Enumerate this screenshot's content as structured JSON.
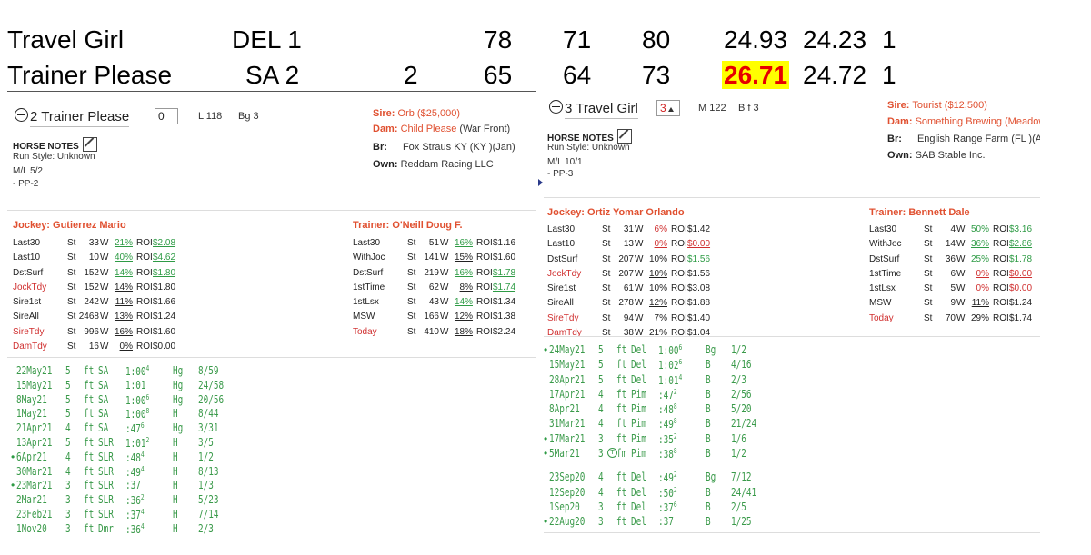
{
  "summary": {
    "rows": [
      {
        "name": "Travel Girl",
        "track": "DEL 1",
        "extra": "",
        "c1": "78",
        "c2": "71",
        "c3": "80",
        "c4": "24.93",
        "c5": "24.23",
        "c6": "1",
        "highlight": false
      },
      {
        "name": "Trainer Please",
        "track": "SA 2",
        "extra": "2",
        "c1": "65",
        "c2": "64",
        "c3": "73",
        "c4": "26.71",
        "c5": "24.72",
        "c6": "1",
        "highlight": true
      }
    ],
    "highlight_color": "#ffff00",
    "highlight_text_color": "#e60000"
  },
  "left": {
    "title": "2 Trainer Please",
    "pg_value": "0",
    "ml_info": "L 118",
    "sex": "Bg 3",
    "sire_label": "Sire:",
    "sire_value": "Orb ($25,000)",
    "dam_label": "Dam:",
    "dam_value": "Child Please",
    "dam_extra": "(War Front)",
    "br_label": "Br:",
    "br_value": "Fox Straus KY (KY )(Jan)",
    "own_label": "Own:",
    "own_value": "Reddam Racing LLC",
    "notes_label": "HORSE NOTES",
    "run_style": "Run Style: Unknown",
    "ml": "M/L  5/2",
    "pp": "-  PP-2",
    "jockey_header": "Jockey: Gutierrez Mario",
    "trainer_header": "Trainer: O'Neill Doug F.",
    "jockey_stats": [
      {
        "label": "Last30",
        "st": "St",
        "n": "33",
        "w": "W",
        "pct": "21%",
        "roi": "ROI",
        "val": "$2.08",
        "label_red": false,
        "pct_color": "green",
        "val_color": "green"
      },
      {
        "label": "Last10",
        "st": "St",
        "n": "10",
        "w": "W",
        "pct": "40%",
        "roi": "ROI",
        "val": "$4.62",
        "label_red": false,
        "pct_color": "green",
        "val_color": "green"
      },
      {
        "label": "DstSurf",
        "st": "St",
        "n": "152",
        "w": "W",
        "pct": "14%",
        "roi": "ROI",
        "val": "$1.80",
        "label_red": false,
        "pct_color": "green",
        "val_color": "green"
      },
      {
        "label": "JockTdy",
        "st": "St",
        "n": "152",
        "w": "W",
        "pct": "14%",
        "roi": "ROI",
        "val": "$1.80",
        "label_red": true,
        "pct_color": "",
        "val_color": ""
      },
      {
        "label": "Sire1st",
        "st": "St",
        "n": "242",
        "w": "W",
        "pct": "11%",
        "roi": "ROI",
        "val": "$1.66",
        "label_red": false,
        "pct_color": "",
        "val_color": ""
      },
      {
        "label": "SireAll",
        "st": "St",
        "n": "2468",
        "w": "W",
        "pct": "13%",
        "roi": "ROI",
        "val": "$1.24",
        "label_red": false,
        "pct_color": "",
        "val_color": ""
      },
      {
        "label": "SireTdy",
        "st": "St",
        "n": "996",
        "w": "W",
        "pct": "16%",
        "roi": "ROI",
        "val": "$1.60",
        "label_red": true,
        "pct_color": "",
        "val_color": ""
      },
      {
        "label": "DamTdy",
        "st": "St",
        "n": "16",
        "w": "W",
        "pct": "0%",
        "roi": "ROI",
        "val": "$0.00",
        "label_red": true,
        "pct_color": "",
        "val_color": ""
      }
    ],
    "trainer_stats": [
      {
        "label": "Last30",
        "st": "St",
        "n": "51",
        "w": "W",
        "pct": "16%",
        "roi": "ROI",
        "val": "$1.16",
        "label_red": false,
        "pct_color": "green",
        "val_color": ""
      },
      {
        "label": "WithJoc",
        "st": "St",
        "n": "141",
        "w": "W",
        "pct": "15%",
        "roi": "ROI",
        "val": "$1.60",
        "label_red": false,
        "pct_color": "",
        "val_color": ""
      },
      {
        "label": "DstSurf",
        "st": "St",
        "n": "219",
        "w": "W",
        "pct": "16%",
        "roi": "ROI",
        "val": "$1.78",
        "label_red": false,
        "pct_color": "green",
        "val_color": "green"
      },
      {
        "label": "1stTime",
        "st": "St",
        "n": "62",
        "w": "W",
        "pct": "8%",
        "roi": "ROI",
        "val": "$1.74",
        "label_red": false,
        "pct_color": "",
        "val_color": "green"
      },
      {
        "label": "1stLsx",
        "st": "St",
        "n": "43",
        "w": "W",
        "pct": "14%",
        "roi": "ROI",
        "val": "$1.34",
        "label_red": false,
        "pct_color": "green",
        "val_color": ""
      },
      {
        "label": "MSW",
        "st": "St",
        "n": "166",
        "w": "W",
        "pct": "12%",
        "roi": "ROI",
        "val": "$1.38",
        "label_red": false,
        "pct_color": "",
        "val_color": ""
      },
      {
        "label": "Today",
        "st": "St",
        "n": "410",
        "w": "W",
        "pct": "18%",
        "roi": "ROI",
        "val": "$2.24",
        "label_red": true,
        "pct_color": "",
        "val_color": ""
      }
    ],
    "workouts": [
      {
        "dot": "",
        "date": "22May21",
        "dist": "5",
        "surf": "ft",
        "trk": "SA",
        "time": "1:00",
        "sup": "4",
        "type": "Hg",
        "rank": "8/59"
      },
      {
        "dot": "",
        "date": "15May21",
        "dist": "5",
        "surf": "ft",
        "trk": "SA",
        "time": "1:01",
        "sup": "",
        "type": "Hg",
        "rank": "24/58"
      },
      {
        "dot": "",
        "date": "8May21",
        "dist": "5",
        "surf": "ft",
        "trk": "SA",
        "time": "1:00",
        "sup": "6",
        "type": "Hg",
        "rank": "20/56"
      },
      {
        "dot": "",
        "date": "1May21",
        "dist": "5",
        "surf": "ft",
        "trk": "SA",
        "time": "1:00",
        "sup": "8",
        "type": "H",
        "rank": "8/44"
      },
      {
        "dot": "",
        "date": "21Apr21",
        "dist": "4",
        "surf": "ft",
        "trk": "SA",
        "time": ":47",
        "sup": "6",
        "type": "Hg",
        "rank": "3/31"
      },
      {
        "dot": "",
        "date": "13Apr21",
        "dist": "5",
        "surf": "ft",
        "trk": "SLR",
        "time": "1:01",
        "sup": "2",
        "type": "H",
        "rank": "3/5"
      },
      {
        "dot": "•",
        "date": "6Apr21",
        "dist": "4",
        "surf": "ft",
        "trk": "SLR",
        "time": ":48",
        "sup": "4",
        "type": "H",
        "rank": "1/2"
      },
      {
        "dot": "",
        "date": "30Mar21",
        "dist": "4",
        "surf": "ft",
        "trk": "SLR",
        "time": ":49",
        "sup": "4",
        "type": "H",
        "rank": "8/13"
      },
      {
        "dot": "•",
        "date": "23Mar21",
        "dist": "3",
        "surf": "ft",
        "trk": "SLR",
        "time": ":37",
        "sup": "",
        "type": "H",
        "rank": "1/3"
      },
      {
        "dot": "",
        "date": "2Mar21",
        "dist": "3",
        "surf": "ft",
        "trk": "SLR",
        "time": ":36",
        "sup": "2",
        "type": "H",
        "rank": "5/23"
      },
      {
        "dot": "",
        "date": "23Feb21",
        "dist": "3",
        "surf": "ft",
        "trk": "SLR",
        "time": ":37",
        "sup": "4",
        "type": "H",
        "rank": "7/14"
      },
      {
        "dot": "",
        "date": "1Nov20",
        "dist": "3",
        "surf": "ft",
        "trk": "Dmr",
        "time": ":36",
        "sup": "4",
        "type": "H",
        "rank": "2/3"
      }
    ]
  },
  "right": {
    "title": "3 Travel Girl",
    "pg_value": "3",
    "ml_info": "M 122",
    "sex": "B f 3",
    "sire_label": "Sire:",
    "sire_value": "Tourist ($12,500)",
    "dam_label": "Dam:",
    "dam_value": "Something Brewing (Meadow",
    "br_label": "Br:",
    "br_value": "English Range Farm (FL )(Apr",
    "own_label": "Own:",
    "own_value": "SAB Stable Inc.",
    "notes_label": "HORSE NOTES",
    "run_style": "Run Style: Unknown",
    "ml": "M/L  10/1",
    "pp": "-  PP-3",
    "jockey_header": "Jockey: Ortiz Yomar Orlando",
    "trainer_header": "Trainer: Bennett Dale",
    "jockey_stats": [
      {
        "label": "Last30",
        "st": "St",
        "n": "31",
        "w": "W",
        "pct": "6%",
        "roi": "ROI",
        "val": "$1.42",
        "label_red": false,
        "pct_color": "red",
        "val_color": ""
      },
      {
        "label": "Last10",
        "st": "St",
        "n": "13",
        "w": "W",
        "pct": "0%",
        "roi": "ROI",
        "val": "$0.00",
        "label_red": false,
        "pct_color": "red",
        "val_color": "red"
      },
      {
        "label": "DstSurf",
        "st": "St",
        "n": "207",
        "w": "W",
        "pct": "10%",
        "roi": "ROI",
        "val": "$1.56",
        "label_red": false,
        "pct_color": "",
        "val_color": "green"
      },
      {
        "label": "JockTdy",
        "st": "St",
        "n": "207",
        "w": "W",
        "pct": "10%",
        "roi": "ROI",
        "val": "$1.56",
        "label_red": true,
        "pct_color": "",
        "val_color": ""
      },
      {
        "label": "Sire1st",
        "st": "St",
        "n": "61",
        "w": "W",
        "pct": "10%",
        "roi": "ROI",
        "val": "$3.08",
        "label_red": false,
        "pct_color": "",
        "val_color": ""
      },
      {
        "label": "SireAll",
        "st": "St",
        "n": "278",
        "w": "W",
        "pct": "12%",
        "roi": "ROI",
        "val": "$1.88",
        "label_red": false,
        "pct_color": "",
        "val_color": ""
      },
      {
        "label": "SireTdy",
        "st": "St",
        "n": "94",
        "w": "W",
        "pct": "7%",
        "roi": "ROI",
        "val": "$1.40",
        "label_red": true,
        "pct_color": "",
        "val_color": ""
      },
      {
        "label": "DamTdy",
        "st": "St",
        "n": "38",
        "w": "W",
        "pct": "21%",
        "roi": "ROI",
        "val": "$1.04",
        "label_red": true,
        "pct_color": "",
        "val_color": ""
      }
    ],
    "trainer_stats": [
      {
        "label": "Last30",
        "st": "St",
        "n": "4",
        "w": "W",
        "pct": "50%",
        "roi": "ROI",
        "val": "$3.16",
        "label_red": false,
        "pct_color": "green",
        "val_color": "green"
      },
      {
        "label": "WithJoc",
        "st": "St",
        "n": "14",
        "w": "W",
        "pct": "36%",
        "roi": "ROI",
        "val": "$2.86",
        "label_red": false,
        "pct_color": "green",
        "val_color": "green"
      },
      {
        "label": "DstSurf",
        "st": "St",
        "n": "36",
        "w": "W",
        "pct": "25%",
        "roi": "ROI",
        "val": "$1.78",
        "label_red": false,
        "pct_color": "green",
        "val_color": "green"
      },
      {
        "label": "1stTime",
        "st": "St",
        "n": "6",
        "w": "W",
        "pct": "0%",
        "roi": "ROI",
        "val": "$0.00",
        "label_red": false,
        "pct_color": "red",
        "val_color": "red"
      },
      {
        "label": "1stLsx",
        "st": "St",
        "n": "5",
        "w": "W",
        "pct": "0%",
        "roi": "ROI",
        "val": "$0.00",
        "label_red": false,
        "pct_color": "red",
        "val_color": "red"
      },
      {
        "label": "MSW",
        "st": "St",
        "n": "9",
        "w": "W",
        "pct": "11%",
        "roi": "ROI",
        "val": "$1.24",
        "label_red": false,
        "pct_color": "",
        "val_color": ""
      },
      {
        "label": "Today",
        "st": "St",
        "n": "70",
        "w": "W",
        "pct": "29%",
        "roi": "ROI",
        "val": "$1.74",
        "label_red": true,
        "pct_color": "",
        "val_color": ""
      }
    ],
    "workouts": [
      {
        "dot": "•",
        "date": "24May21",
        "dist": "5",
        "surf": "ft",
        "trk": "Del",
        "time": "1:00",
        "sup": "6",
        "type": "Bg",
        "rank": "1/2"
      },
      {
        "dot": "",
        "date": "15May21",
        "dist": "5",
        "surf": "ft",
        "trk": "Del",
        "time": "1:02",
        "sup": "6",
        "type": "B",
        "rank": "4/16"
      },
      {
        "dot": "",
        "date": "28Apr21",
        "dist": "5",
        "surf": "ft",
        "trk": "Del",
        "time": "1:01",
        "sup": "4",
        "type": "B",
        "rank": "2/3"
      },
      {
        "dot": "",
        "date": "17Apr21",
        "dist": "4",
        "surf": "ft",
        "trk": "Pim",
        "time": ":47",
        "sup": "2",
        "type": "B",
        "rank": "2/56"
      },
      {
        "dot": "",
        "date": "8Apr21",
        "dist": "4",
        "surf": "ft",
        "trk": "Pim",
        "time": ":48",
        "sup": "8",
        "type": "B",
        "rank": "5/20"
      },
      {
        "dot": "",
        "date": "31Mar21",
        "dist": "4",
        "surf": "ft",
        "trk": "Pim",
        "time": ":49",
        "sup": "8",
        "type": "B",
        "rank": "21/24"
      },
      {
        "dot": "•",
        "date": "17Mar21",
        "dist": "3",
        "surf": "ft",
        "trk": "Pim",
        "time": ":35",
        "sup": "2",
        "type": "B",
        "rank": "1/6"
      },
      {
        "dot": "•",
        "date": "5Mar21",
        "dist": "3",
        "surf": "fm",
        "trk": "Pim",
        "time": ":38",
        "sup": "8",
        "type": "B",
        "rank": "1/2",
        "circle": "T"
      },
      {
        "gap": true
      },
      {
        "dot": "",
        "date": "23Sep20",
        "dist": "4",
        "surf": "ft",
        "trk": "Del",
        "time": ":49",
        "sup": "2",
        "type": "Bg",
        "rank": "7/12"
      },
      {
        "dot": "",
        "date": "12Sep20",
        "dist": "4",
        "surf": "ft",
        "trk": "Del",
        "time": ":50",
        "sup": "2",
        "type": "B",
        "rank": "24/41"
      },
      {
        "dot": "",
        "date": "1Sep20",
        "dist": "3",
        "surf": "ft",
        "trk": "Del",
        "time": ":37",
        "sup": "6",
        "type": "B",
        "rank": "2/5"
      },
      {
        "dot": "•",
        "date": "22Aug20",
        "dist": "3",
        "surf": "ft",
        "trk": "Del",
        "time": ":37",
        "sup": "",
        "type": "B",
        "rank": "1/25"
      }
    ]
  }
}
